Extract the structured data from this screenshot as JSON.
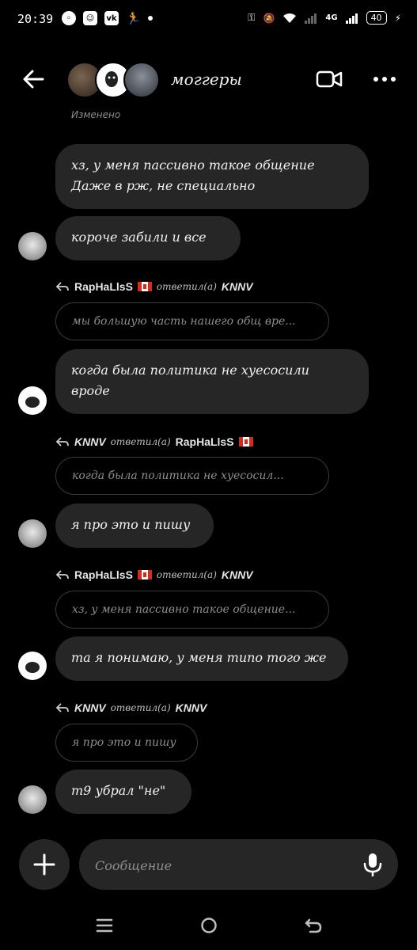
{
  "status_bar": {
    "time": "20:39",
    "network": "4G",
    "battery": "40"
  },
  "header": {
    "title": "моггеры"
  },
  "edited_label": "Изменено",
  "messages": [
    {
      "type": "bubble",
      "text": "хз, у меня пассивно такое общение\nДаже в рж, не специально"
    },
    {
      "type": "bubble",
      "text": "короче забили и все"
    },
    {
      "type": "reply",
      "from": "RapHaLlsS",
      "verb": "ответил(а)",
      "to": "KNNV",
      "quote": "мы большую часть нашего общ вре...",
      "text": "когда была политика не хуесосили\nвроде"
    },
    {
      "type": "reply",
      "from": "KNNV",
      "verb": "ответил(а)",
      "to": "RapHaLlsS",
      "quote": "когда была политика не хуесосил...",
      "text": "я про это и пишу"
    },
    {
      "type": "reply",
      "from": "RapHaLlsS",
      "verb": "ответил(а)",
      "to": "KNNV",
      "quote": "хз, у меня пассивно такое общение...",
      "text": "та я понимаю, у меня типо того же"
    },
    {
      "type": "reply",
      "from": "KNNV",
      "verb": "ответил(а)",
      "to": "KNNV",
      "quote": "я про это и пишу",
      "text": "т9 убрал \"не\""
    }
  ],
  "composer": {
    "placeholder": "Сообщение"
  },
  "colors": {
    "background": "#000000",
    "bubble": "#262626",
    "secondary_text": "#8e8e8e"
  }
}
